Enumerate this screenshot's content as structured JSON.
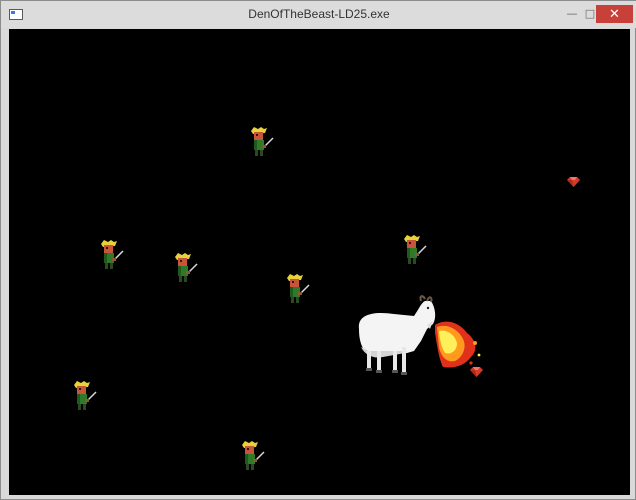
{
  "window": {
    "title": "DenOfTheBeast-LD25.exe",
    "minimize_glyph": "—",
    "maximize_glyph": "□",
    "close_glyph": "✕"
  },
  "game": {
    "background_color": "#000000",
    "villagers": [
      {
        "name": "villager-1"
      },
      {
        "name": "villager-2"
      },
      {
        "name": "villager-3"
      },
      {
        "name": "villager-4"
      },
      {
        "name": "villager-5"
      },
      {
        "name": "villager-6"
      },
      {
        "name": "villager-7"
      }
    ],
    "gems": [
      {
        "name": "ruby-gem-1",
        "color": "#d83a2a"
      },
      {
        "name": "ruby-gem-2",
        "color": "#d83a2a"
      }
    ],
    "player": {
      "name": "goat-beast",
      "color": "#f2f2f2"
    },
    "fire": {
      "colors": [
        "#ffef5a",
        "#ff9a1f",
        "#e0311a"
      ]
    }
  }
}
